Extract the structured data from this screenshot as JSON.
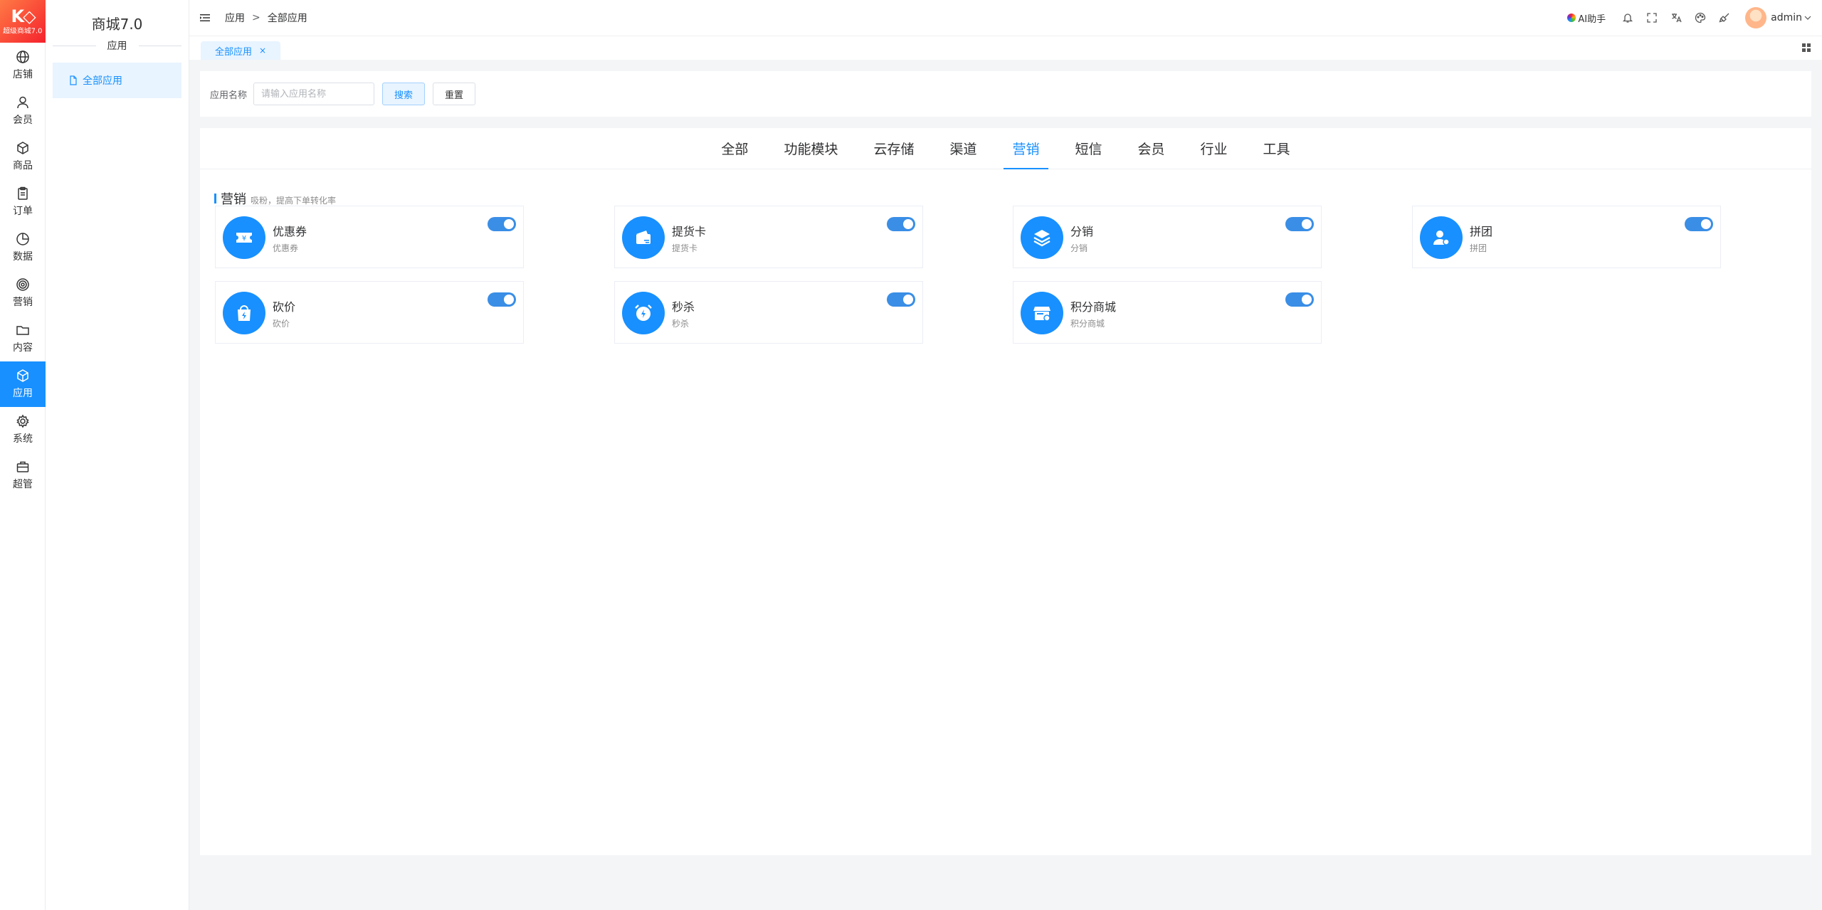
{
  "logo": {
    "mark": "K◇",
    "text": "超级商城7.0"
  },
  "rail": [
    {
      "label": "店铺",
      "icon": "globe-icon"
    },
    {
      "label": "会员",
      "icon": "user-icon"
    },
    {
      "label": "商品",
      "icon": "cube-icon"
    },
    {
      "label": "订单",
      "icon": "clipboard-icon"
    },
    {
      "label": "数据",
      "icon": "pie-icon"
    },
    {
      "label": "营销",
      "icon": "target-icon"
    },
    {
      "label": "内容",
      "icon": "folder-icon"
    },
    {
      "label": "应用",
      "icon": "app-cube-icon",
      "active": true
    },
    {
      "label": "系统",
      "icon": "gear-icon"
    },
    {
      "label": "超管",
      "icon": "briefcase-icon"
    }
  ],
  "subnav": {
    "title": "商城7.0",
    "section": "应用",
    "items": [
      {
        "label": "全部应用",
        "icon": "document-icon"
      }
    ]
  },
  "header": {
    "breadcrumb": [
      "应用",
      "全部应用"
    ],
    "breadcrumb_sep": ">",
    "ai_label": "AI助手",
    "user": "admin"
  },
  "tabs": [
    {
      "label": "全部应用",
      "close": "×"
    }
  ],
  "search": {
    "label": "应用名称",
    "placeholder": "请输入应用名称",
    "value": "",
    "search_btn": "搜索",
    "reset_btn": "重置"
  },
  "categories": [
    {
      "label": "全部"
    },
    {
      "label": "功能模块"
    },
    {
      "label": "云存储"
    },
    {
      "label": "渠道"
    },
    {
      "label": "营销",
      "active": true
    },
    {
      "label": "短信"
    },
    {
      "label": "会员"
    },
    {
      "label": "行业"
    },
    {
      "label": "工具"
    }
  ],
  "section": {
    "title": "营销",
    "desc": "吸粉，提高下单转化率"
  },
  "apps": [
    {
      "name": "优惠券",
      "sub": "优惠券",
      "icon": "coupon-icon",
      "enabled": true
    },
    {
      "name": "提货卡",
      "sub": "提货卡",
      "icon": "card-wallet-icon",
      "enabled": true
    },
    {
      "name": "分销",
      "sub": "分销",
      "icon": "layers-icon",
      "enabled": true
    },
    {
      "name": "拼团",
      "sub": "拼团",
      "icon": "group-users-icon",
      "enabled": true
    },
    {
      "name": "砍价",
      "sub": "砍价",
      "icon": "flash-bag-icon",
      "enabled": true
    },
    {
      "name": "秒杀",
      "sub": "秒杀",
      "icon": "alarm-flash-icon",
      "enabled": true
    },
    {
      "name": "积分商城",
      "sub": "积分商城",
      "icon": "store-icon",
      "enabled": true
    }
  ],
  "colors": {
    "accent": "#1890ff",
    "switch_on": "#3a8ee6",
    "logo": "#f5222d"
  }
}
